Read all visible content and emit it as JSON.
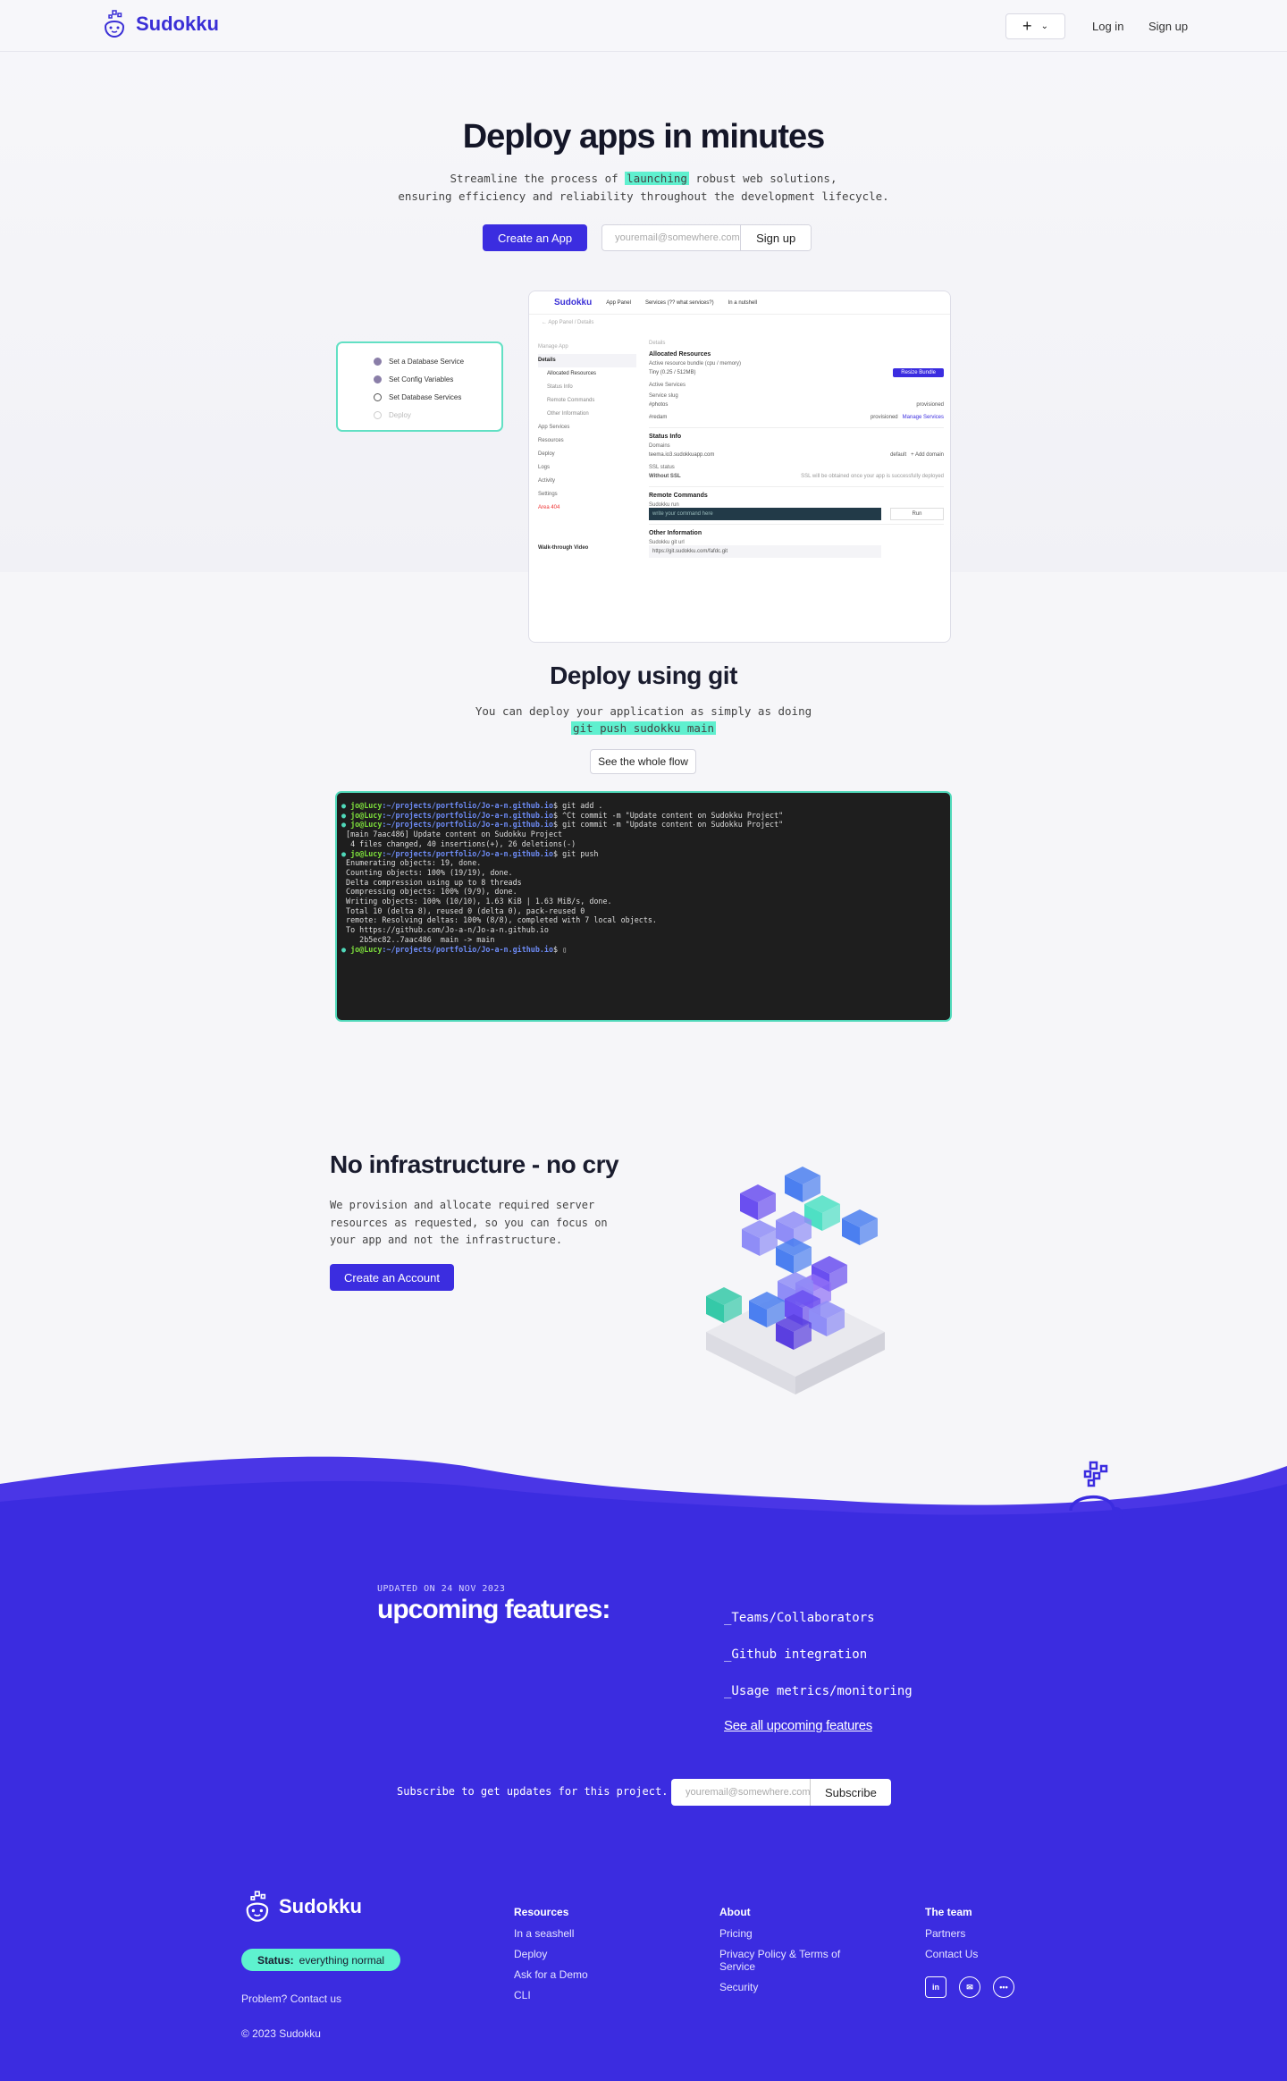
{
  "header": {
    "logo_text": "Sudokku",
    "plus_label": "+",
    "login": "Log in",
    "signup": "Sign up"
  },
  "hero": {
    "title": "Deploy apps in minutes",
    "sub_line1_pre": "Streamline the process of ",
    "sub_line1_hl": "launching",
    "sub_line1_post": " robust web solutions,",
    "sub_line2": "ensuring efficiency and reliability throughout the development lifecycle.",
    "create_app": "Create an App",
    "email_placeholder": "youremail@somewhere.com",
    "signup_btn": "Sign up"
  },
  "app_preview": {
    "logo": "Sudokku",
    "nav": [
      "App Panel",
      "Services (?? what services?)",
      "In a nutshell"
    ],
    "breadcrumb": "← App Panel / Details",
    "side_header": "Manage App",
    "side_items": [
      "Details",
      "Allocated Resources",
      "Status Info",
      "Remote Commands",
      "Other Information",
      "App Services",
      "Resources",
      "Deploy",
      "Logs",
      "Activity",
      "Settings",
      "Area 404"
    ],
    "walkthrough": "Walk-through Video",
    "details_label": "Details",
    "allocated": "Allocated Resources",
    "bundle_label": "Active resource bundle (cpu / memory)",
    "bundle_value": "Tiny (0.25 / 512MB)",
    "resize": "Resize Bundle",
    "active_services": "Active Services",
    "service_slug": "Service slug",
    "svc1": "#photos",
    "svc2": "#redam",
    "provisioned": "provisioned",
    "manage_services": "Manage Services",
    "status_info": "Status Info",
    "domains": "Domains",
    "domain1": "teema.io3.sudokkuapp.com",
    "default": "default",
    "add_domain": "+ Add domain",
    "ssl_status": "SSL status",
    "ssl_value": "Without SSL",
    "ssl_note": "SSL will be obtained once your app is successfully deployed",
    "remote_commands": "Remote Commands",
    "sudokku_run": "Sudokku run",
    "cmd_placeholder": "write your command here",
    "run": "Run",
    "other_info": "Other Information",
    "sudokku_git": "Sudokku git url",
    "git_url": "https://git.sudokku.com/fafdc.git"
  },
  "steps": [
    {
      "label": "Set a Database Service",
      "state": "done"
    },
    {
      "label": "Set Config Variables",
      "state": "done"
    },
    {
      "label": "Set Database Services",
      "state": "current"
    },
    {
      "label": "Deploy",
      "state": "pending"
    }
  ],
  "git": {
    "title": "Deploy using git",
    "sub_line1": "You can deploy your application as simply as doing",
    "sub_code": "git push sudokku main",
    "flow_btn": "See the whole flow",
    "terminal": [
      {
        "prompt": true,
        "cmd": "git add ."
      },
      {
        "prompt": true,
        "cmd": "^Ct commit -m \"Update content on Sudokku Project\""
      },
      {
        "prompt": true,
        "cmd": "git commit -m \"Update content on Sudokku Project\""
      },
      {
        "prompt": false,
        "text": " [main 7aac486] Update content on Sudokku Project"
      },
      {
        "prompt": false,
        "text": "  4 files changed, 40 insertions(+), 26 deletions(-)"
      },
      {
        "prompt": true,
        "cmd": "git push"
      },
      {
        "prompt": false,
        "text": " Enumerating objects: 19, done."
      },
      {
        "prompt": false,
        "text": " Counting objects: 100% (19/19), done."
      },
      {
        "prompt": false,
        "text": " Delta compression using up to 8 threads"
      },
      {
        "prompt": false,
        "text": " Compressing objects: 100% (9/9), done."
      },
      {
        "prompt": false,
        "text": " Writing objects: 100% (10/10), 1.63 KiB | 1.63 MiB/s, done."
      },
      {
        "prompt": false,
        "text": " Total 10 (delta 8), reused 0 (delta 0), pack-reused 0"
      },
      {
        "prompt": false,
        "text": " remote: Resolving deltas: 100% (8/8), completed with 7 local objects."
      },
      {
        "prompt": false,
        "text": " To https://github.com/Jo-a-n/Jo-a-n.github.io"
      },
      {
        "prompt": false,
        "text": "    2b5ec82..7aac486  main -> main"
      },
      {
        "prompt": true,
        "cmd": "▯"
      }
    ],
    "prompt_user": "jo@Lucy",
    "prompt_path": ":~/projects/portfolio/Jo-a-n.github.io",
    "prompt_sign": "$ "
  },
  "infra": {
    "title": "No infrastructure - no cry",
    "text": "We provision and allocate required server resources as requested, so you can focus on your app and not the infrastructure.",
    "button": "Create an Account"
  },
  "features": {
    "updated": "UPDATED ON 24 NOV 2023",
    "title": "upcoming features:",
    "items": [
      "_Teams/Collaborators",
      "_Github integration",
      "_Usage metrics/monitoring"
    ],
    "see_all": "See all upcoming features",
    "subscribe_text": "Subscribe to get updates for this project.",
    "email_placeholder": "youremail@somewhere.com",
    "subscribe_btn": "Subscribe"
  },
  "footer": {
    "logo_text": "Sudokku",
    "status_label": "Status:",
    "status_value": "everything normal",
    "problem": "Problem? Contact us",
    "copyright": "© 2023 Sudokku",
    "resources": {
      "title": "Resources",
      "links": [
        "In a seashell",
        "Deploy",
        "Ask for a Demo",
        "CLI"
      ]
    },
    "about": {
      "title": "About",
      "links": [
        "Pricing",
        "Privacy Policy & Terms of Service",
        "Security"
      ]
    },
    "team": {
      "title": "The team",
      "links": [
        "Partners",
        "Contact Us"
      ]
    },
    "socials": [
      {
        "icon": "linkedin-icon",
        "glyph": "in"
      },
      {
        "icon": "mail-icon",
        "glyph": "✉"
      },
      {
        "icon": "more-icon",
        "glyph": "•••"
      }
    ]
  },
  "colors": {
    "accent": "#3b2de0",
    "teal": "#5ff0cf",
    "footer_bg": "#3b2ce0"
  }
}
